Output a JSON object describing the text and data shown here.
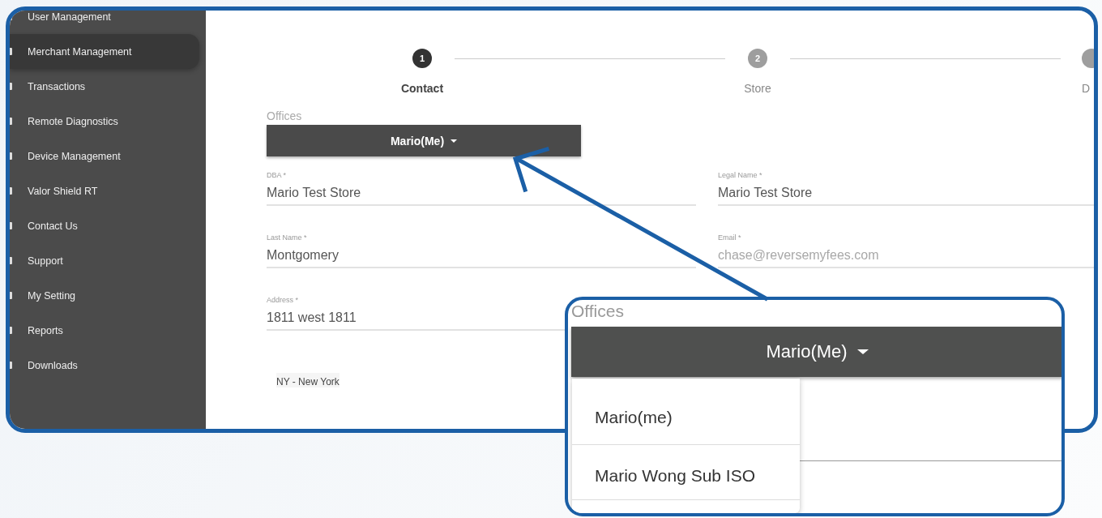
{
  "sidebar": {
    "items": [
      {
        "label": "User Management",
        "selected": false
      },
      {
        "label": "Merchant Management",
        "selected": true
      },
      {
        "label": "Transactions",
        "selected": false
      },
      {
        "label": "Remote Diagnostics",
        "selected": false
      },
      {
        "label": "Device Management",
        "selected": false
      },
      {
        "label": "Valor Shield RT",
        "selected": false
      },
      {
        "label": "Contact Us",
        "selected": false
      },
      {
        "label": "Support",
        "selected": false
      },
      {
        "label": "My Setting",
        "selected": false
      },
      {
        "label": "Reports",
        "selected": false
      },
      {
        "label": "Downloads",
        "selected": false
      }
    ]
  },
  "stepper": [
    {
      "number": "1",
      "label": "Contact",
      "selected": true
    },
    {
      "number": "2",
      "label": "Store",
      "selected": false
    },
    {
      "label": "D",
      "selected": false
    }
  ],
  "offices": {
    "label": "Offices",
    "value": "Mario(Me)"
  },
  "fields": [
    {
      "label": "DBA *",
      "value": "Mario Test Store"
    },
    {
      "label": "Legal Name *",
      "value": "Mario Test Store"
    },
    {
      "label": "Last Name *",
      "value": "Montgomery"
    },
    {
      "label": "Email *",
      "value": "chase@reversemyfees.com"
    },
    {
      "label": "Address *",
      "value": "1811 west 1811"
    }
  ],
  "state_chip": "NY - New York",
  "callout": {
    "label": "Offices",
    "value": "Mario(Me)",
    "options": [
      "Mario(me)",
      "Mario Wong Sub ISO"
    ]
  }
}
